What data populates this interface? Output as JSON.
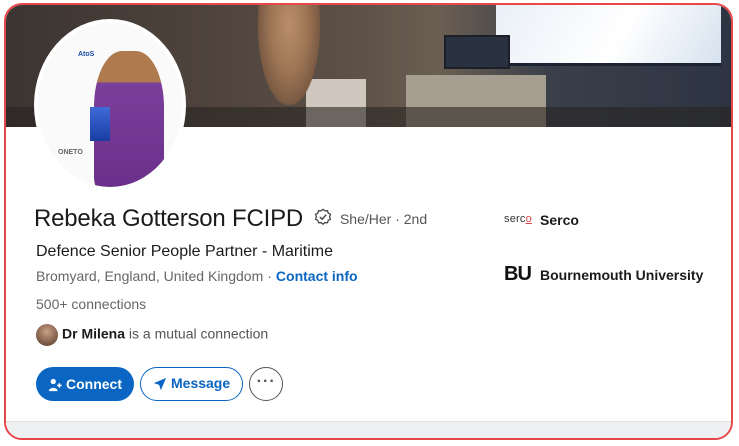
{
  "profile": {
    "name": "Rebeka Gotterson FCIPD",
    "pronouns": "She/Her · 2nd",
    "headline": "Defence Senior People Partner - Maritime",
    "location": "Bromyard, England, United Kingdom",
    "contact_label": "Contact info",
    "connections": "500+ connections",
    "mutual": {
      "name": "Dr Milena",
      "text": " is a mutual connection"
    }
  },
  "avatar_board_logos": [
    "AtoS",
    "ONETO"
  ],
  "actions": {
    "connect_label": "Connect",
    "message_label": "Message",
    "more_label": "···"
  },
  "organizations": [
    {
      "logo": "serco",
      "name": "Serco"
    },
    {
      "logo": "BU",
      "name": "Bournemouth University"
    }
  ],
  "colors": {
    "accent": "#0a66c2",
    "frame_border": "#e8474a"
  },
  "icons": [
    "verified-icon",
    "add-person-icon",
    "send-icon",
    "more-icon"
  ]
}
